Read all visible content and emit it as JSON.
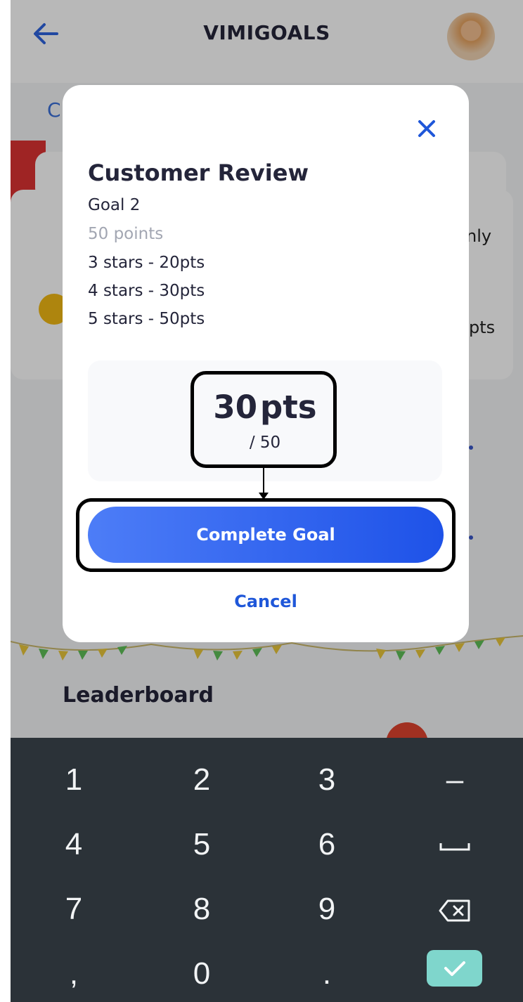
{
  "appbar": {
    "title": "VIMIGOALS"
  },
  "background": {
    "tab_fragment": "C",
    "card_fragment_only": "nly",
    "card_fragment_pts": "pts",
    "leaderboard_title": "Leaderboard"
  },
  "modal": {
    "title": "Customer Review",
    "goal": "Goal 2",
    "points": "50 points",
    "tiers": [
      "3 stars - 20pts",
      "4 stars - 30pts",
      "5 stars - 50pts"
    ],
    "entered_points": "30",
    "points_unit": "pts",
    "max_points": "/ 50",
    "complete_label": "Complete Goal",
    "cancel_label": "Cancel"
  },
  "keyboard": {
    "rows": [
      [
        "1",
        "2",
        "3",
        "–"
      ],
      [
        "4",
        "5",
        "6",
        "space"
      ],
      [
        "7",
        "8",
        "9",
        "backspace"
      ],
      [
        ",",
        "0",
        ".",
        "enter"
      ]
    ]
  },
  "colors": {
    "accent": "#1f57d9",
    "keyboard_bg": "#2b3238",
    "enter_key": "#7fd6cc"
  }
}
